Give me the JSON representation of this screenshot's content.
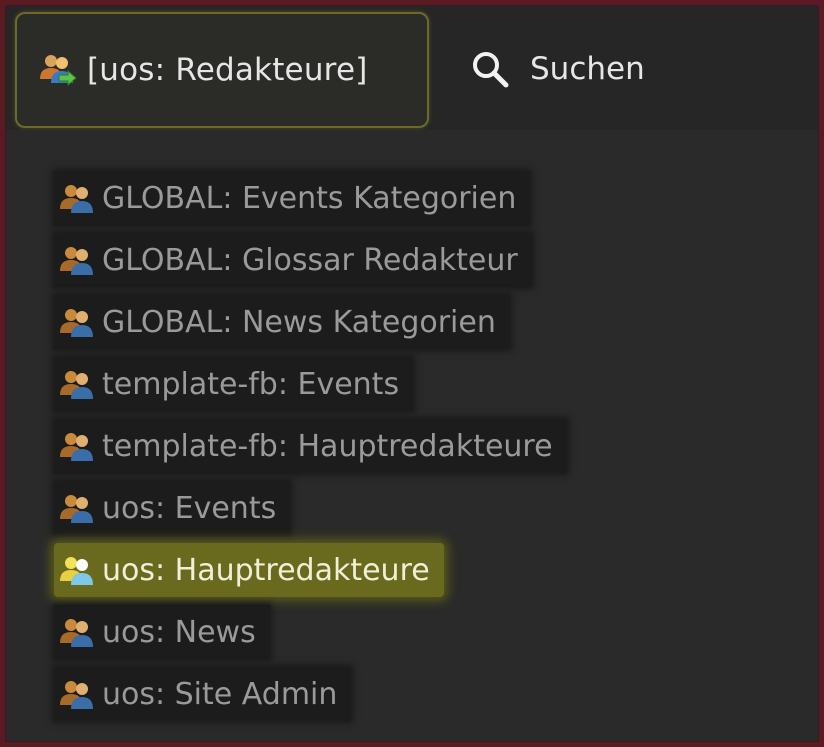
{
  "header": {
    "current_group": "[uos: Redakteure]",
    "current_group_icon": "group-switch-icon",
    "search_label": "Suchen",
    "search_icon": "search-icon"
  },
  "groups": [
    {
      "label": "GLOBAL: Events Kategorien",
      "icon": "user-group-icon",
      "active": false
    },
    {
      "label": "GLOBAL: Glossar Redakteur",
      "icon": "user-group-icon",
      "active": false
    },
    {
      "label": "GLOBAL: News Kategorien",
      "icon": "user-group-icon",
      "active": false
    },
    {
      "label": "template-fb: Events",
      "icon": "user-group-icon",
      "active": false
    },
    {
      "label": "template-fb: Hauptredakteure",
      "icon": "user-group-icon",
      "active": false
    },
    {
      "label": "uos: Events",
      "icon": "user-group-icon",
      "active": false
    },
    {
      "label": "uos: Hauptredakteure",
      "icon": "user-group-icon",
      "active": true
    },
    {
      "label": "uos: News",
      "icon": "user-group-icon",
      "active": false
    },
    {
      "label": "uos: Site Admin",
      "icon": "user-group-icon",
      "active": false
    }
  ],
  "colors": {
    "background": "#2a2a2a",
    "border": "#5a1a22",
    "highlight": "#6a6a1e",
    "text": "#e6e6e6",
    "muted_text": "#9a9a9a"
  }
}
